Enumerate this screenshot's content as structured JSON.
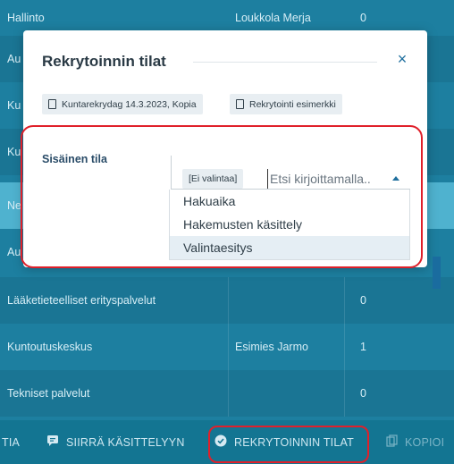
{
  "background_table": {
    "rows": [
      {
        "c1": "Hallinto",
        "c2": "Loukkola Merja",
        "c3": "0"
      },
      {
        "c1": "Au",
        "c2": "",
        "c3": ""
      },
      {
        "c1": "Ku",
        "c2": "",
        "c3": ""
      },
      {
        "c1": "Ku",
        "c2": "",
        "c3": ""
      },
      {
        "c1": "Ne",
        "c2": "",
        "c3": ""
      },
      {
        "c1": "Au",
        "c2": "",
        "c3": ""
      },
      {
        "c1": "Lääketieteelliset erityspalvelut",
        "c2": "",
        "c3": "0"
      },
      {
        "c1": "Kuntoutuskeskus",
        "c2": "Esimies Jarmo",
        "c3": "1"
      },
      {
        "c1": "Tekniset palvelut",
        "c2": "",
        "c3": "0"
      }
    ]
  },
  "toolbar": {
    "partial_left": "TIA",
    "move_label": "SIIRRÄ KÄSITTELYYN",
    "status_label": "REKRYTOINNIN TILAT",
    "copy_label": "KOPIOI"
  },
  "dialog": {
    "title": "Rekrytoinnin tilat",
    "close_symbol": "×",
    "chips": [
      "Kuntarekrydag 14.3.2023, Kopia",
      "Rekrytointi esimerkki"
    ],
    "field_label": "Sisäinen tila",
    "selected_tag": "[Ei valintaa]",
    "search_placeholder": "Etsi kirjoittamalla..",
    "options": [
      "Hakuaika",
      "Hakemusten käsittely",
      "Valintaesitys"
    ]
  },
  "colors": {
    "accent": "#1f6f9e",
    "annotation": "#e0202a"
  }
}
